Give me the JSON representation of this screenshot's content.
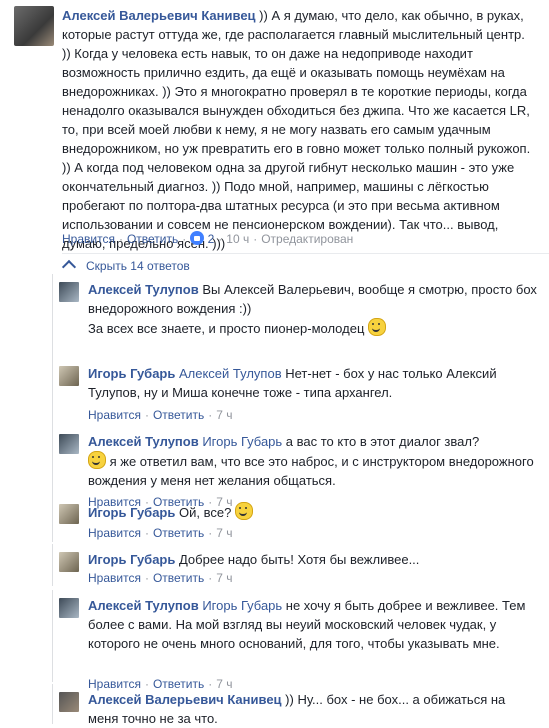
{
  "main": {
    "author": "Алексей Валерьевич Канивец",
    "text": " )) А я думаю, что дело, как обычно, в руках, которые растут оттуда же, где располагается главный мыслительный центр. )) Когда у человека есть навык, то он даже на недоприводе находит возможность прилично ездить, да ещё и оказывать помощь неумёхам на внедорожниках. )) Это я многократно проверял в те короткие периоды, когда ненадолго оказывался вынужден обходиться без джипа. Что же касается LR, то, при всей моей любви к нему, я не могу назвать его самым удачным внедорожником, но уж превратить его в говно может только полный рукожоп. )) А когда под человеком одна за другой гибнут несколько машин - это уже окончательный диагноз. )) Подо мной, например, машины с лёгкостью пробегают по полтора-два штатных ресурса (и это при весьма активном использовании и совсем не пенсионерском вождении). Так что... вывод, думаю, предельно ясен. )))",
    "like": "Нравится",
    "reply": "Ответить",
    "likes_count": "2",
    "time": "10 ч",
    "edited": "Отредактирован"
  },
  "hide_replies": "Скрыть 14 ответов",
  "replies": [
    {
      "author": "Алексей Тулупов",
      "tag": "",
      "text": " Вы Алексей Валерьевич, вообще я смотрю, просто бох внедорожного вождения :))",
      "text2": "За всех все знаете, и просто пионер-молодец ",
      "time": "7 ч"
    },
    {
      "author": "Игорь Губарь",
      "tag": " Алексей Тулупов",
      "text": " Нет-нет - бох у нас только Алексий Тулупов, ну и Миша конечне тоже - типа архангел.",
      "time": "7 ч"
    },
    {
      "author": "Алексей Тулупов",
      "tag": " Игорь Губарь",
      "text": " а вас то кто в этот диалог звал?",
      "text2": " я же ответил вам, что все это наброс, и с инструктором внедорожного вождения у меня нет желания общаться.",
      "time": "7 ч"
    },
    {
      "author": "Игорь Губарь",
      "tag": "",
      "text": " Ой, все? ",
      "time": "7 ч"
    },
    {
      "author": "Игорь Губарь",
      "tag": "",
      "text": " Добрее надо быть! Хотя бы вежливее...",
      "time": "7 ч"
    },
    {
      "author": "Алексей Тулупов",
      "tag": " Игорь Губарь",
      "text": " не хочу я быть добрее и вежливее. Тем более с вами. На мой взгляд вы неуий московский человек чудак, у которого не очень много оснований, для того, чтобы указывать мне.",
      "time": "7 ч"
    },
    {
      "author": "Алексей Валерьевич Канивец",
      "tag": "",
      "text": " )) Ну... бох - не бох... а обижаться на меня точно не за что.",
      "time": ""
    }
  ],
  "actions": {
    "like": "Нравится",
    "reply": "Ответить"
  }
}
